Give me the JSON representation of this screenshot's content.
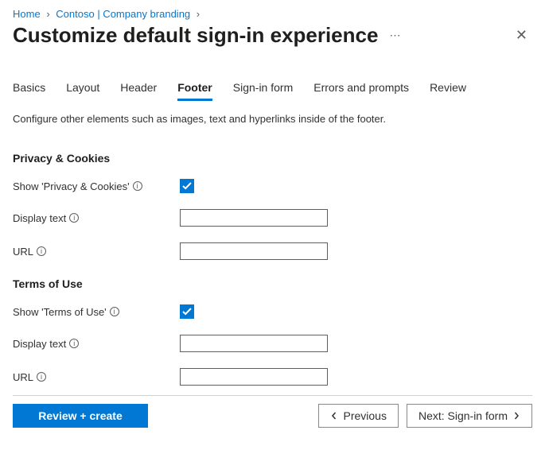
{
  "breadcrumb": {
    "items": [
      "Home",
      "Contoso | Company branding"
    ]
  },
  "header": {
    "title": "Customize default sign-in experience"
  },
  "tabs": {
    "items": [
      {
        "label": "Basics"
      },
      {
        "label": "Layout"
      },
      {
        "label": "Header"
      },
      {
        "label": "Footer",
        "active": true
      },
      {
        "label": "Sign-in form"
      },
      {
        "label": "Errors and prompts"
      },
      {
        "label": "Review"
      }
    ]
  },
  "description": "Configure other elements such as images, text and hyperlinks inside of the footer.",
  "sections": {
    "privacy": {
      "title": "Privacy & Cookies",
      "show_label": "Show 'Privacy & Cookies'",
      "show_checked": true,
      "display_text_label": "Display text",
      "display_text_value": "",
      "url_label": "URL",
      "url_value": ""
    },
    "terms": {
      "title": "Terms of Use",
      "show_label": "Show 'Terms of Use'",
      "show_checked": true,
      "display_text_label": "Display text",
      "display_text_value": "",
      "url_label": "URL",
      "url_value": ""
    }
  },
  "footer": {
    "primary_label": "Review + create",
    "prev_label": "Previous",
    "next_label": "Next: Sign-in form"
  }
}
